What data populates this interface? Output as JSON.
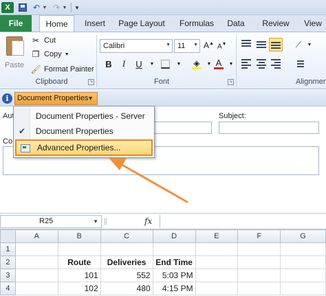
{
  "qat": {
    "app_icon_letter": "X",
    "icons": [
      "excel-logo-icon",
      "save-icon",
      "undo-icon",
      "redo-icon",
      "customize-qat-icon"
    ]
  },
  "tabs": [
    {
      "label": "File"
    },
    {
      "label": "Home"
    },
    {
      "label": "Insert"
    },
    {
      "label": "Page Layout"
    },
    {
      "label": "Formulas"
    },
    {
      "label": "Data"
    },
    {
      "label": "Review"
    },
    {
      "label": "View"
    }
  ],
  "ribbon": {
    "clipboard": {
      "paste": "Paste",
      "cut": "Cut",
      "copy": "Copy",
      "format_painter": "Format Painter",
      "group_label": "Clipboard"
    },
    "font": {
      "font_name": "Calibri",
      "font_size": "11",
      "bold": "B",
      "italic": "I",
      "underline": "U",
      "group_label": "Font",
      "font_color": "#d9251c",
      "highlight_color": "#fff200"
    },
    "alignment": {
      "group_label": "Alignment"
    }
  },
  "doc_panel": {
    "button_label": "Document Properties",
    "author_label": "Aut",
    "subject_label": "Subject:",
    "comments_label": "Co"
  },
  "menu": {
    "items": [
      {
        "label": "Document Properties - Server",
        "checked": false
      },
      {
        "label": "Document Properties",
        "checked": true
      },
      {
        "label": "Advanced Properties...",
        "checked": false,
        "highlighted": true
      }
    ],
    "highlight_border_color": "#e58a1f"
  },
  "formula_bar": {
    "name_box": "R25",
    "fx": "fx",
    "formula": ""
  },
  "sheet": {
    "columns": [
      "A",
      "B",
      "C",
      "D",
      "E",
      "F",
      "G"
    ],
    "rows": [
      {
        "num": "1",
        "cells": [
          "",
          "",
          "",
          "",
          "",
          "",
          ""
        ]
      },
      {
        "num": "2",
        "cells": [
          "",
          "Route",
          "Deliveries",
          "End Time",
          "",
          "",
          ""
        ]
      },
      {
        "num": "3",
        "cells": [
          "",
          "101",
          "552",
          "5:03 PM",
          "",
          "",
          ""
        ]
      },
      {
        "num": "4",
        "cells": [
          "",
          "102",
          "480",
          "4:15 PM",
          "",
          "",
          ""
        ]
      }
    ]
  },
  "colors": {
    "file_tab": "#2a8a49",
    "accent_orange": "#f4a138",
    "callout_arrow": "#f0913a"
  }
}
